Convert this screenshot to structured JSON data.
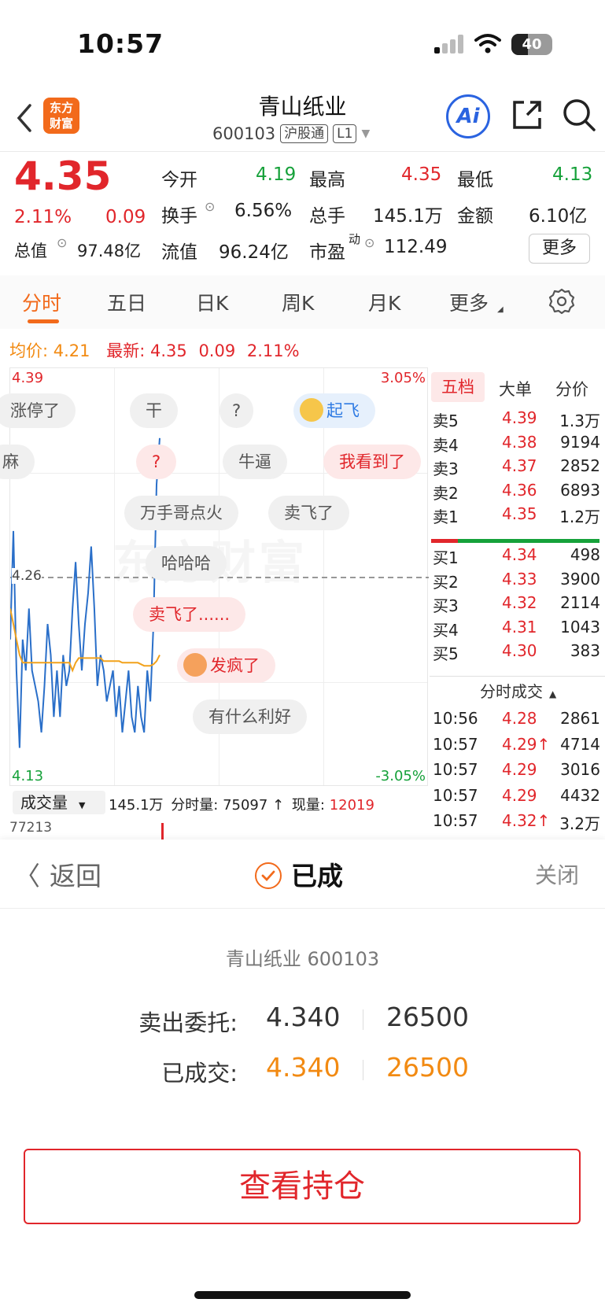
{
  "status_bar": {
    "time": "10:57",
    "battery": "40"
  },
  "header": {
    "title": "青山纸业",
    "code": "600103",
    "tag1": "沪股通",
    "tag2": "L1",
    "logo_top": "东方",
    "logo_bottom": "财富",
    "ai_label": "Ai"
  },
  "quote": {
    "price": "4.35",
    "change_pct": "2.11%",
    "change": "0.09",
    "open_label": "今开",
    "open": "4.19",
    "high_label": "最高",
    "high": "4.35",
    "low_label": "最低",
    "low": "4.13",
    "turnover_label": "换手",
    "turnover": "6.56%",
    "total_lots_label": "总手",
    "total_lots": "145.1万",
    "amount_label": "金额",
    "amount": "6.10亿",
    "mkt_cap_label": "总值",
    "mkt_cap": "97.48亿",
    "float_cap_label": "流值",
    "float_cap": "96.24亿",
    "pe_label": "市盈",
    "pe_sup": "动",
    "pe": "112.49",
    "more_label": "更多"
  },
  "tabs": [
    "分时",
    "五日",
    "日K",
    "周K",
    "月K",
    "更多"
  ],
  "avg_line": {
    "avg_label": "均价:",
    "avg": "4.21",
    "latest_label": "最新:",
    "latest": "4.35",
    "chg": "0.09",
    "pct": "2.11%"
  },
  "chart": {
    "top_price": "4.39",
    "bottom_price": "4.13",
    "top_pct": "3.05%",
    "bottom_pct": "-3.05%",
    "mid_price": "4.26",
    "watermark": "东方财富",
    "bubbles": [
      "涨停了",
      "干",
      "?",
      "起飞",
      "麻",
      "?",
      "牛逼",
      "我看到了",
      "万手哥点火",
      "卖飞了",
      "哈哈哈",
      "卖飞了......",
      "发疯了",
      "有什么利好"
    ]
  },
  "chart_data": {
    "type": "line",
    "title": "",
    "ylim": [
      4.13,
      4.39
    ],
    "series": [
      {
        "values": [
          4.22,
          4.29,
          4.2,
          4.15,
          4.22,
          4.2,
          4.24,
          4.2,
          4.19,
          4.18,
          4.16,
          4.19,
          4.23,
          4.21,
          4.17,
          4.2,
          4.17,
          4.21,
          4.19,
          4.2,
          4.24,
          4.27,
          4.23,
          4.2,
          4.23,
          4.25,
          4.28,
          4.24,
          4.19,
          4.21,
          4.2,
          4.18,
          4.19,
          4.2,
          4.17,
          4.19,
          4.16,
          4.18,
          4.2,
          4.17,
          4.16,
          4.19,
          4.17,
          4.16,
          4.2,
          4.18,
          4.23,
          4.32,
          4.35
        ]
      },
      {
        "values": [
          4.24,
          4.23,
          4.22,
          4.21,
          4.205,
          4.205,
          4.205,
          4.205,
          4.205,
          4.205,
          4.205,
          4.205,
          4.205,
          4.205,
          4.205,
          4.205,
          4.205,
          4.205,
          4.205,
          4.205,
          4.2,
          4.205,
          4.208,
          4.208,
          4.208,
          4.208,
          4.208,
          4.208,
          4.208,
          4.208,
          4.206,
          4.206,
          4.206,
          4.206,
          4.206,
          4.206,
          4.205,
          4.205,
          4.205,
          4.205,
          4.205,
          4.205,
          4.204,
          4.203,
          4.203,
          4.203,
          4.204,
          4.206,
          4.21
        ]
      }
    ]
  },
  "book": {
    "tabs": [
      "五档",
      "大单",
      "分价"
    ],
    "asks": [
      {
        "label": "卖5",
        "price": "4.39",
        "vol": "1.3万"
      },
      {
        "label": "卖4",
        "price": "4.38",
        "vol": "9194"
      },
      {
        "label": "卖3",
        "price": "4.37",
        "vol": "2852"
      },
      {
        "label": "卖2",
        "price": "4.36",
        "vol": "6893"
      },
      {
        "label": "卖1",
        "price": "4.35",
        "vol": "1.2万"
      }
    ],
    "bids": [
      {
        "label": "买1",
        "price": "4.34",
        "vol": "498"
      },
      {
        "label": "买2",
        "price": "4.33",
        "vol": "3900"
      },
      {
        "label": "买3",
        "price": "4.32",
        "vol": "2114"
      },
      {
        "label": "买4",
        "price": "4.31",
        "vol": "1043"
      },
      {
        "label": "买5",
        "price": "4.30",
        "vol": "383"
      }
    ],
    "trades_title": "分时成交",
    "trades": [
      {
        "time": "10:56",
        "price": "4.28",
        "vol": "2861"
      },
      {
        "time": "10:57",
        "price": "4.29↑",
        "vol": "4714"
      },
      {
        "time": "10:57",
        "price": "4.29",
        "vol": "3016"
      },
      {
        "time": "10:57",
        "price": "4.29",
        "vol": "4432"
      },
      {
        "time": "10:57",
        "price": "4.32↑",
        "vol": "3.2万"
      }
    ]
  },
  "volume": {
    "selector": "成交量",
    "total": "145.1万",
    "interval_label": "分时量:",
    "interval": "75097 ↑",
    "now_label": "现量:",
    "now": "12019",
    "axis": "77213"
  },
  "dialog": {
    "back": "返回",
    "status": "已成",
    "close": "关闭",
    "stock": "青山纸业 600103",
    "order_label": "卖出委托:",
    "order_price": "4.340",
    "order_qty": "26500",
    "filled_label": "已成交:",
    "filled_price": "4.340",
    "filled_qty": "26500",
    "position_button": "查看持仓"
  },
  "colors": {
    "up": "#e1262b",
    "down": "#16a13a",
    "accent": "#f26a1b",
    "price_line": "#2a6fc9",
    "avg_line": "#f2a21b"
  }
}
